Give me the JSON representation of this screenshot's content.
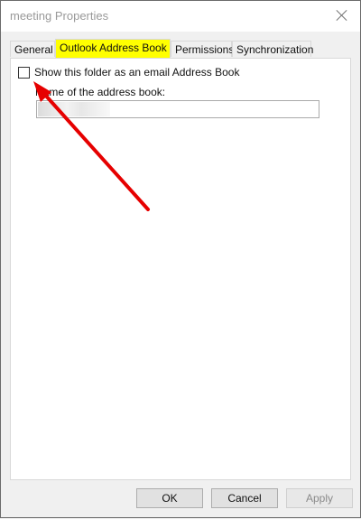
{
  "window": {
    "title": "meeting Properties"
  },
  "tabs": [
    {
      "label": "General"
    },
    {
      "label": "Outlook Address Book"
    },
    {
      "label": "Permissions"
    },
    {
      "label": "Synchronization"
    }
  ],
  "active_tab": "Outlook Address Book",
  "panel": {
    "checkbox_label": "Show this folder as an email Address Book",
    "checkbox_checked": false,
    "name_label": "Name of the address book:",
    "name_value": ""
  },
  "buttons": {
    "ok": "OK",
    "cancel": "Cancel",
    "apply": "Apply"
  },
  "annotation": {
    "arrow_color": "#e60000",
    "highlight_color": "#ffff00"
  }
}
